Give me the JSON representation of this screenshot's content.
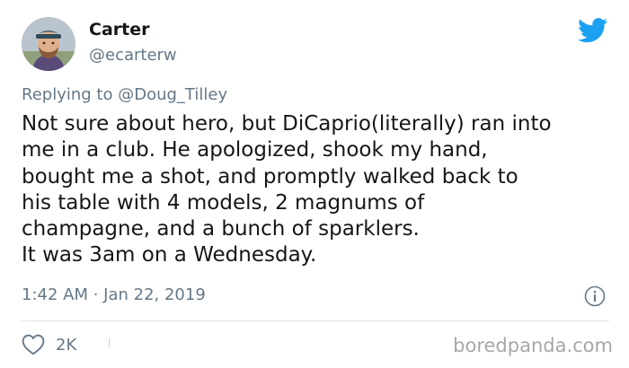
{
  "author": {
    "display_name": "Carter",
    "handle": "@ecarterw"
  },
  "reply": {
    "prefix": "Replying to",
    "mention": "@Doug_Tilley"
  },
  "tweet": {
    "lines": [
      "Not sure about hero, but DiCaprio(literally) ran into",
      "me in a club. He apologized, shook my hand,",
      "bought me a shot, and promptly walked back to",
      "his table with 4 models, 2 magnums of",
      "champagne, and a bunch of sparklers.",
      "It was 3am on a Wednesday."
    ],
    "timestamp": "1:42 AM · Jan 22, 2019"
  },
  "actions": {
    "like_count": "2K"
  },
  "watermark": "boredpanda.com",
  "icons": {
    "brand": "twitter-bird-icon",
    "info": "info-icon",
    "like": "heart-icon"
  },
  "colors": {
    "twitter_blue": "#1da1f2",
    "secondary_text": "#657786",
    "primary_text": "#14171a",
    "divider": "#e1e8ed"
  }
}
